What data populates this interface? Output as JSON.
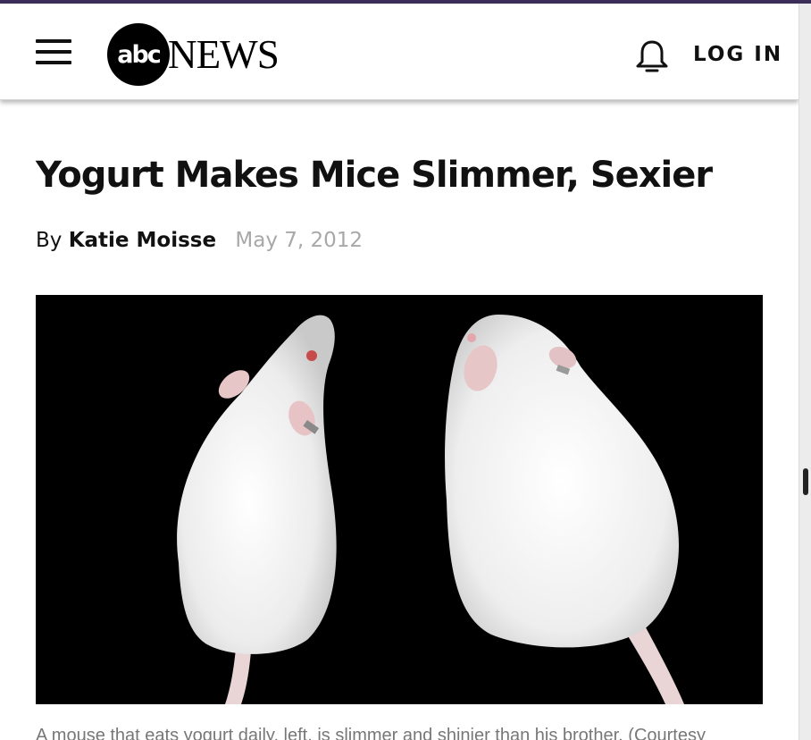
{
  "header": {
    "logo_mark": "abc",
    "logo_wordmark": "NEWS",
    "login_label": "LOG IN",
    "icons": {
      "menu": "hamburger-menu-icon",
      "notifications": "bell-icon"
    }
  },
  "article": {
    "headline": "Yogurt Makes Mice Slimmer, Sexier",
    "byline_prefix": "By",
    "author": "Katie Moisse",
    "date": "May 7, 2012",
    "photo_caption": "A mouse that eats yogurt daily, left, is slimmer and shinier than his brother. (Courtesy"
  },
  "colors": {
    "top_strip": "#3b2f5a",
    "text": "#111111",
    "date_gray": "#a8a8a8",
    "caption_gray": "#777777",
    "photo_background": "#000000"
  }
}
